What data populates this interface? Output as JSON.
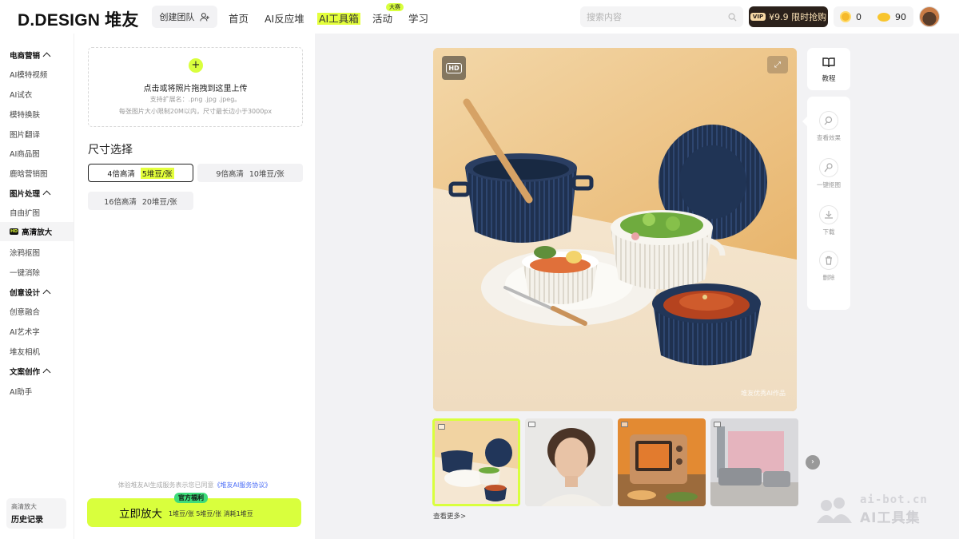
{
  "header": {
    "logo": "D.DESIGN 堆友",
    "team_button": "创建团队",
    "nav": [
      "首页",
      "AI反应堆",
      "AI工具箱",
      "活动",
      "学习"
    ],
    "nav_badge": "大赛",
    "search_placeholder": "搜索内容",
    "vip_tag": "VIP",
    "vip_label": "¥9.9 限时抢购",
    "coins": "0",
    "beans": "90"
  },
  "sidebar": {
    "sections": [
      {
        "title": "电商营销",
        "items": [
          "AI模特视频",
          "AI试衣",
          "模特换肤",
          "图片翻译",
          "AI商品图",
          "鹿晗营销图"
        ]
      },
      {
        "title": "图片处理",
        "items": [
          "自由扩图",
          "高清放大",
          "涂鸦抠图",
          "一键消除"
        ]
      },
      {
        "title": "创意设计",
        "items": [
          "创意融合",
          "AI艺术字",
          "堆友相机"
        ]
      },
      {
        "title": "文案创作",
        "items": [
          "AI助手"
        ]
      }
    ],
    "active_item": "高清放大",
    "hd_mini": "HD",
    "history_small": "高清放大",
    "history_label": "历史记录"
  },
  "panel": {
    "upload_main": "点击或将照片拖拽到这里上传",
    "upload_ext": "支持扩展名：.png .jpg .jpeg。",
    "upload_limit": "每张图片大小限制20M以内，尺寸最长边小于3000px",
    "size_title": "尺寸选择",
    "options": [
      {
        "name": "4倍高清",
        "price": "5堆豆/张",
        "selected": true
      },
      {
        "name": "9倍高清",
        "price": "10堆豆/张",
        "selected": false
      },
      {
        "name": "16倍高清",
        "price": "20堆豆/张",
        "selected": false
      }
    ],
    "agree_text": "体验堆友AI生成服务表示您已同意",
    "agree_link": "《堆友AI服务协议》",
    "go_label": "立即放大",
    "go_badge": "官方福利",
    "go_cost": "1堆豆/张  5堆豆/张  消耗1堆豆"
  },
  "preview": {
    "hd_label": "HD",
    "watermark": "堆友优秀AI作品",
    "tools_top": "教程",
    "tools": [
      "查看效果",
      "一键抠图",
      "下载",
      "删除"
    ],
    "more_label": "查看更多>"
  },
  "corner_watermark": {
    "line1": "ai-bot.cn",
    "line2": "AI工具集"
  },
  "colors": {
    "accent": "#d9ff3d",
    "highlight": "#e4ff3c",
    "vip_bg": "#2b211b",
    "page_bg": "#f2f2f4"
  }
}
